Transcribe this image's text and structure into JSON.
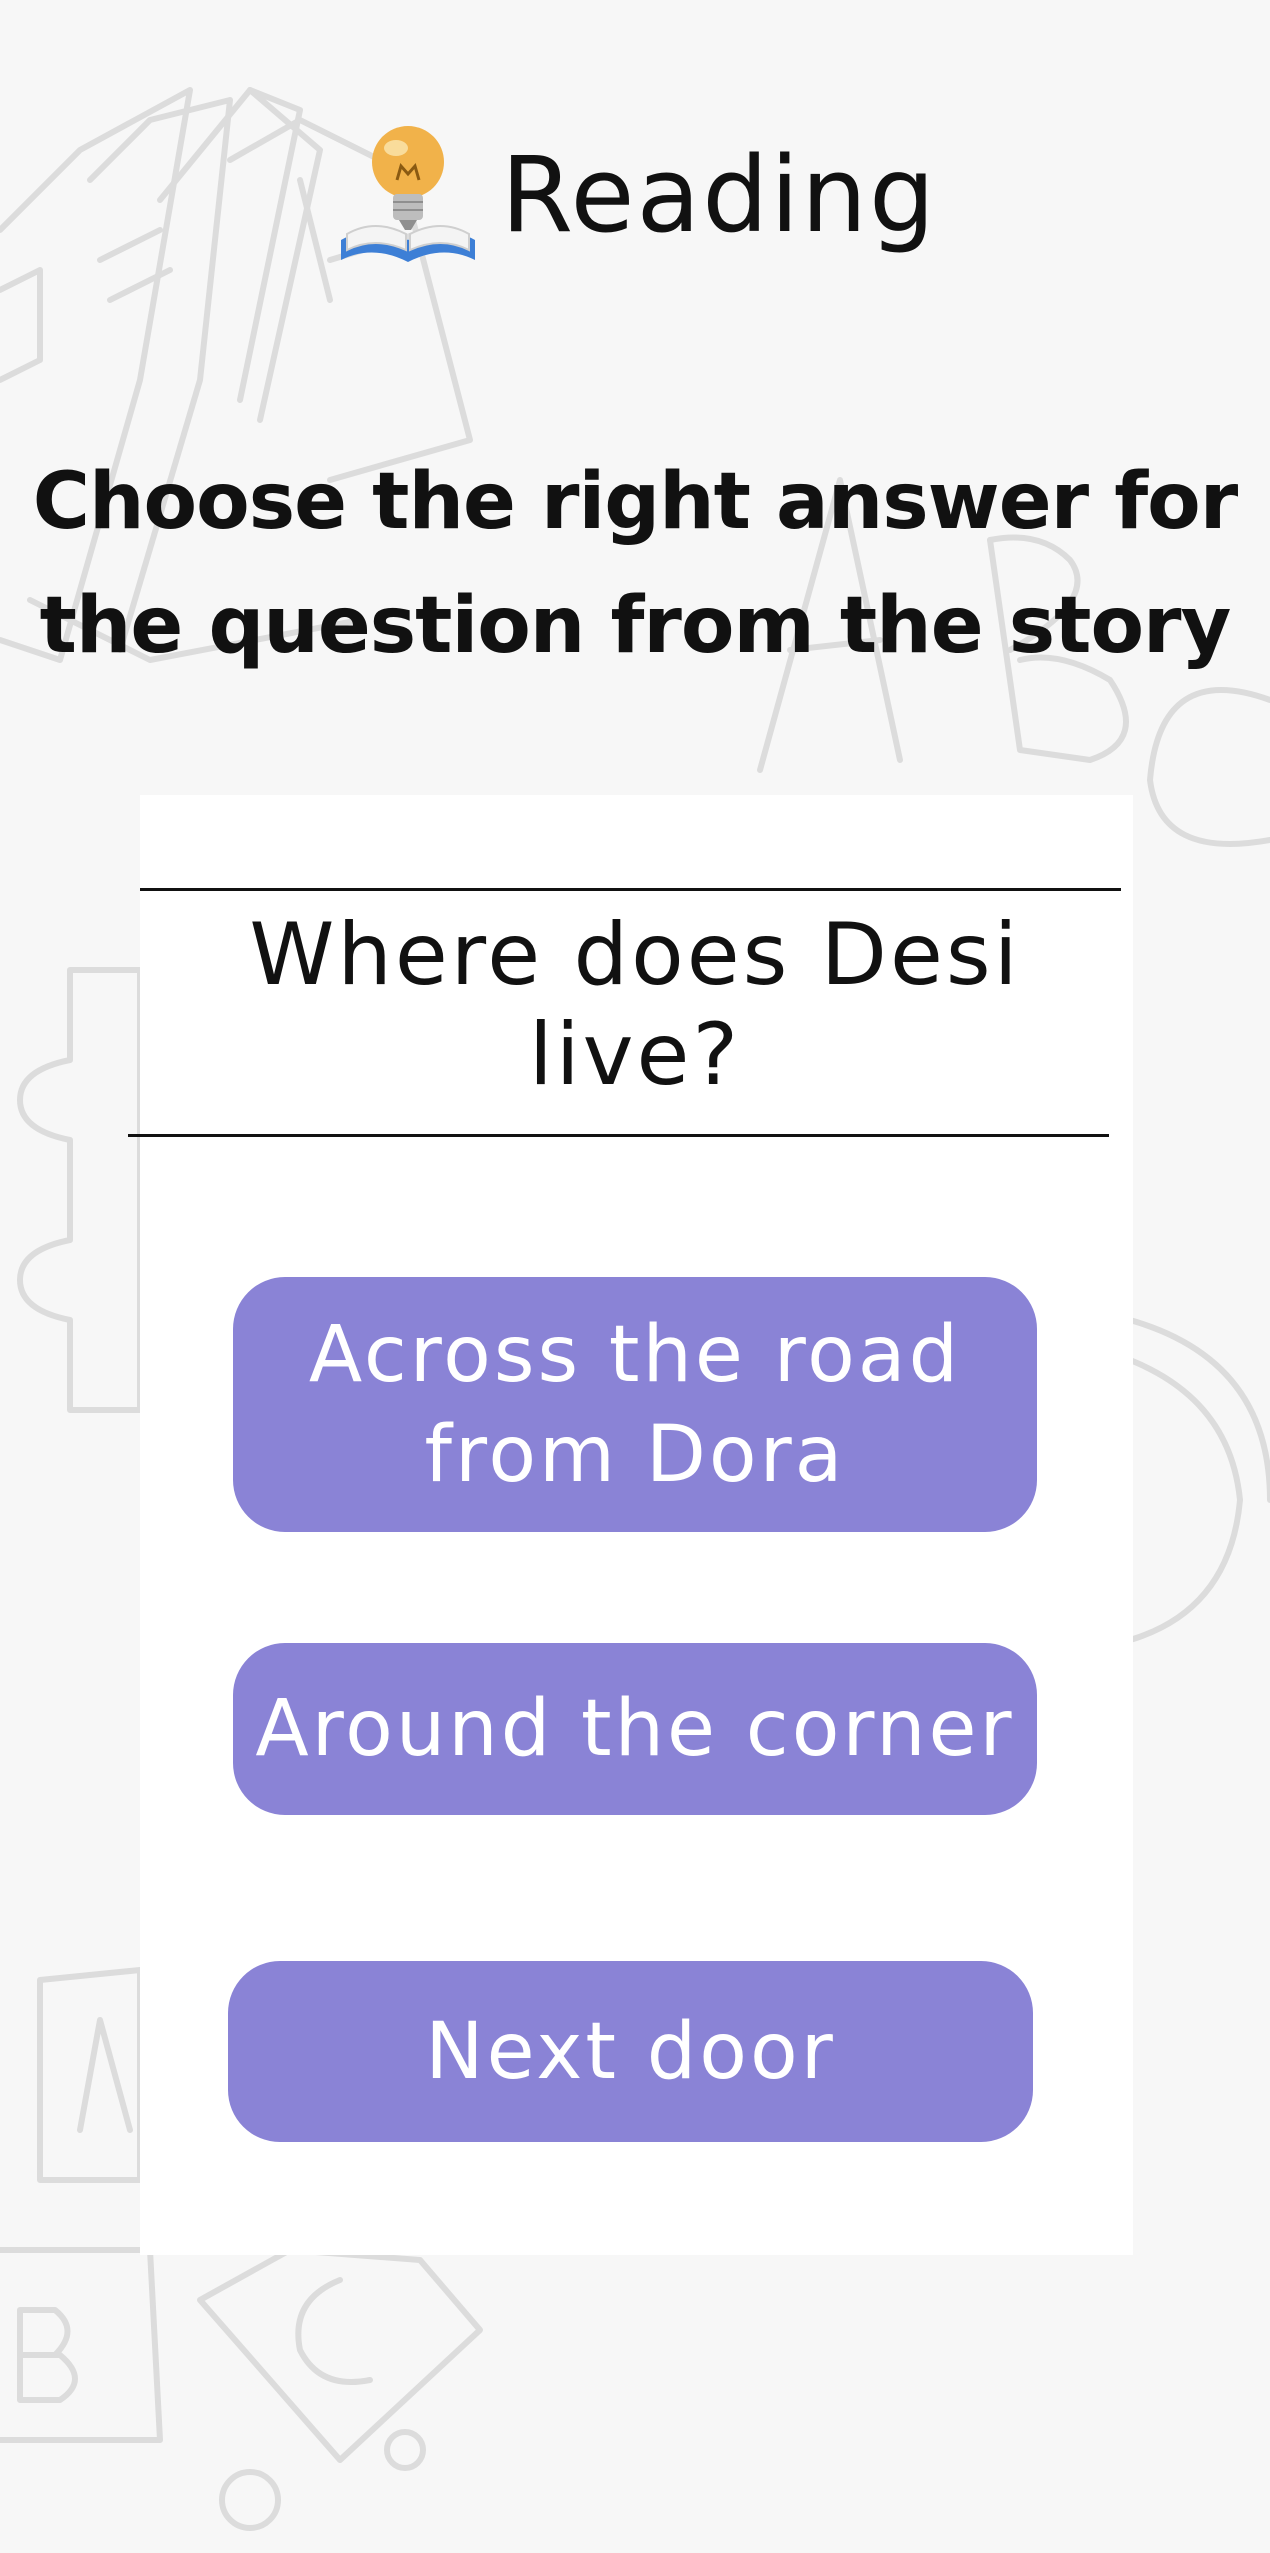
{
  "header": {
    "icon": "book-lightbulb-icon",
    "title": "Reading"
  },
  "instruction": "Choose the right answer for the question from the story",
  "question": "Where does Desi live?",
  "answers": [
    {
      "label": "Across the road from Dora"
    },
    {
      "label": "Around the corner"
    },
    {
      "label": "Next door"
    }
  ],
  "colors": {
    "background": "#f7f7f7",
    "card": "#ffffff",
    "answer_button": "#8a83d6",
    "answer_text": "#ffffff",
    "text": "#111111",
    "doodle": "#dcdcdc"
  }
}
